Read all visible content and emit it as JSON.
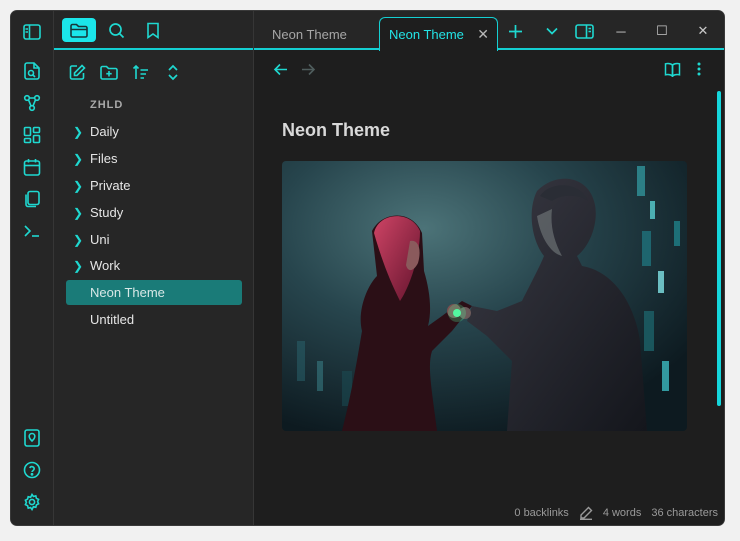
{
  "ribbon": {
    "items": [
      {
        "name": "sidebar-toggle-icon"
      },
      {
        "name": "open-quick-switcher-icon"
      },
      {
        "name": "graph-view-icon"
      },
      {
        "name": "canvas-icon"
      },
      {
        "name": "daily-note-icon"
      },
      {
        "name": "templates-icon"
      },
      {
        "name": "command-palette-icon"
      }
    ],
    "bottom": [
      {
        "name": "vault-switcher-icon"
      },
      {
        "name": "help-icon"
      },
      {
        "name": "settings-icon"
      }
    ]
  },
  "sidebar": {
    "vault_name": "ZHLD",
    "folders": [
      {
        "label": "Daily"
      },
      {
        "label": "Files"
      },
      {
        "label": "Private"
      },
      {
        "label": "Study"
      },
      {
        "label": "Uni"
      },
      {
        "label": "Work"
      }
    ],
    "files": [
      {
        "label": "Neon Theme",
        "selected": true
      },
      {
        "label": "Untitled",
        "selected": false
      }
    ]
  },
  "tabs": [
    {
      "label": "Neon Theme",
      "active": false
    },
    {
      "label": "Neon Theme",
      "active": true
    }
  ],
  "tab_close_glyph": "✕",
  "window_controls": {
    "minimize": "─",
    "maximize": "☐",
    "close": "✕"
  },
  "note": {
    "title": "Neon Theme"
  },
  "status": {
    "backlinks": "0 backlinks",
    "words": "4 words",
    "characters": "36 characters"
  },
  "colors": {
    "accent": "#14cfd2",
    "selected": "#1a7b78",
    "background": "#1e1e1e",
    "panel": "#262626"
  }
}
